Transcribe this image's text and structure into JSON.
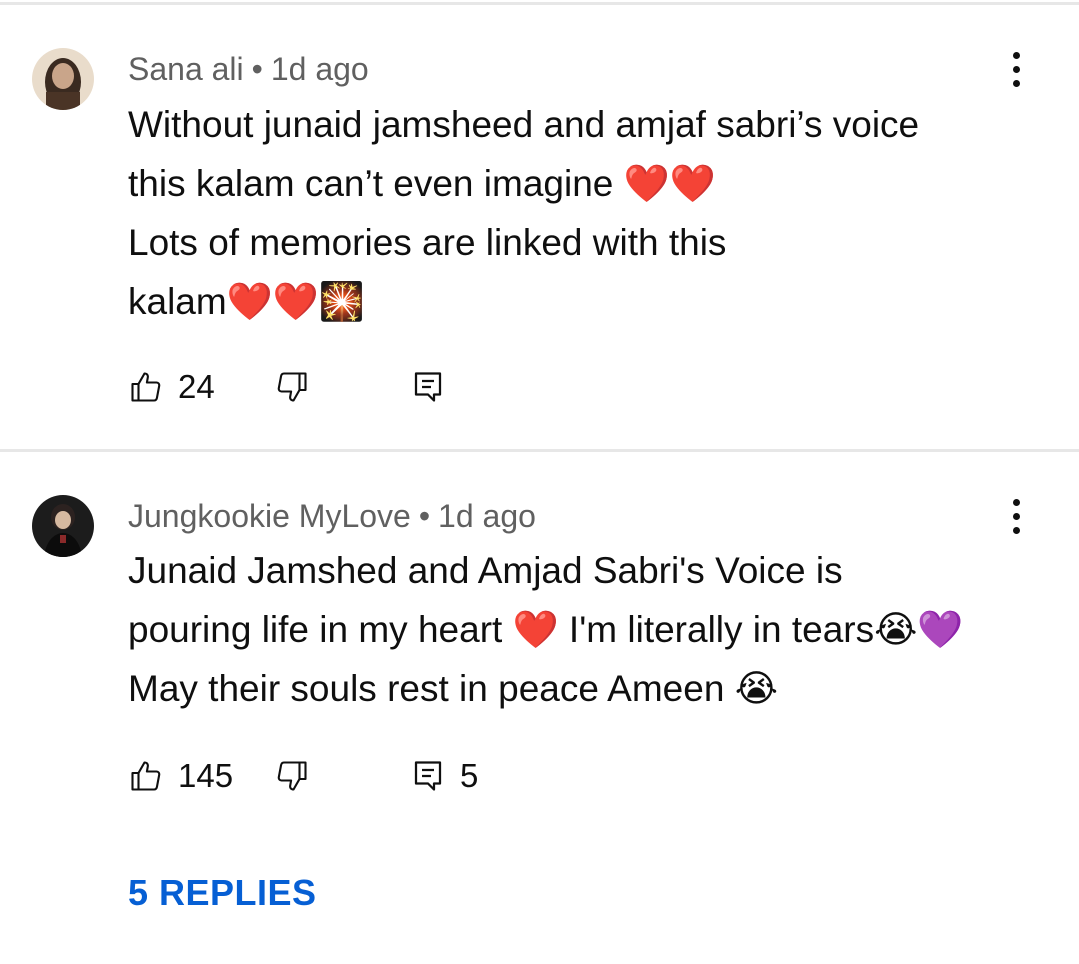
{
  "comments": [
    {
      "author": "Sana ali",
      "time": "1d ago",
      "lines": [
        "Without junaid jamsheed and amjaf sabri’s voice",
        "this kalam can’t even imagine ❤️❤️",
        "Lots of memories are linked with this",
        "kalam❤️❤️🎇"
      ],
      "likes": "24",
      "reply_count": ""
    },
    {
      "author": "Jungkookie MyLove",
      "time": "1d ago",
      "lines": [
        "Junaid Jamshed and Amjad Sabri's Voice is",
        "pouring life in my heart ❤️ I'm literally in tears😭💜",
        "May their souls rest in peace Ameen 😭"
      ],
      "likes": "145",
      "reply_count": "5"
    }
  ],
  "replies_link": "5 REPLIES",
  "icons": {
    "like": "thumb-up-outline-icon",
    "dislike": "thumb-down-outline-icon",
    "reply": "comment-reply-icon",
    "menu": "more-vert-icon"
  },
  "colors": {
    "link": "#065fd4",
    "meta": "#606060",
    "text": "#0f0f0f"
  }
}
